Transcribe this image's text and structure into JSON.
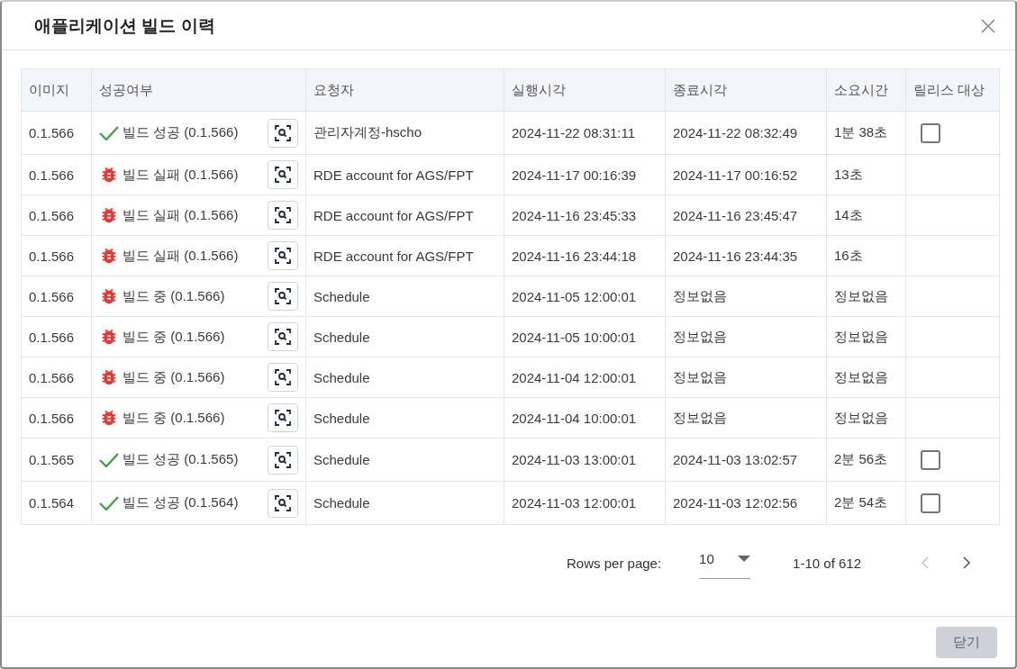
{
  "dialog": {
    "title": "애플리케이션 빌드 이력"
  },
  "table": {
    "columns": [
      "이미지",
      "성공여부",
      "요청자",
      "실행시각",
      "종료시각",
      "소요시간",
      "릴리스 대상"
    ],
    "rows": [
      {
        "image": "0.1.566",
        "kind": "success",
        "status": "빌드 성공 (0.1.566)",
        "requester": "관리자계정-hscho",
        "started": "2024-11-22 08:31:11",
        "ended": "2024-11-22 08:32:49",
        "duration": "1분 38초",
        "release": {
          "checked": false
        }
      },
      {
        "image": "0.1.566",
        "kind": "failed",
        "status": "빌드 실패 (0.1.566)",
        "requester": "RDE account for AGS/FPT",
        "started": "2024-11-17 00:16:39",
        "ended": "2024-11-17 00:16:52",
        "duration": "13초"
      },
      {
        "image": "0.1.566",
        "kind": "failed",
        "status": "빌드 실패 (0.1.566)",
        "requester": "RDE account for AGS/FPT",
        "started": "2024-11-16 23:45:33",
        "ended": "2024-11-16 23:45:47",
        "duration": "14초"
      },
      {
        "image": "0.1.566",
        "kind": "failed",
        "status": "빌드 실패 (0.1.566)",
        "requester": "RDE account for AGS/FPT",
        "started": "2024-11-16 23:44:18",
        "ended": "2024-11-16 23:44:35",
        "duration": "16초"
      },
      {
        "image": "0.1.566",
        "kind": "failed",
        "status": "빌드 중 (0.1.566)",
        "requester": "Schedule",
        "started": "2024-11-05 12:00:01",
        "ended": "정보없음",
        "duration": "정보없음"
      },
      {
        "image": "0.1.566",
        "kind": "failed",
        "status": "빌드 중 (0.1.566)",
        "requester": "Schedule",
        "started": "2024-11-05 10:00:01",
        "ended": "정보없음",
        "duration": "정보없음"
      },
      {
        "image": "0.1.566",
        "kind": "failed",
        "status": "빌드 중 (0.1.566)",
        "requester": "Schedule",
        "started": "2024-11-04 12:00:01",
        "ended": "정보없음",
        "duration": "정보없음"
      },
      {
        "image": "0.1.566",
        "kind": "failed",
        "status": "빌드 중 (0.1.566)",
        "requester": "Schedule",
        "started": "2024-11-04 10:00:01",
        "ended": "정보없음",
        "duration": "정보없음"
      },
      {
        "image": "0.1.565",
        "kind": "success",
        "status": "빌드 성공 (0.1.565)",
        "requester": "Schedule",
        "started": "2024-11-03 13:00:01",
        "ended": "2024-11-03 13:02:57",
        "duration": "2분 56초",
        "release": {
          "checked": false
        }
      },
      {
        "image": "0.1.564",
        "kind": "success",
        "status": "빌드 성공 (0.1.564)",
        "requester": "Schedule",
        "started": "2024-11-03 12:00:01",
        "ended": "2024-11-03 12:02:56",
        "duration": "2분 54초",
        "release": {
          "checked": false
        }
      }
    ]
  },
  "pagination": {
    "rows_per_page_label": "Rows per page:",
    "rows_per_page": "10",
    "range": "1-10 of 612",
    "prev_disabled": true,
    "next_disabled": false
  },
  "footer": {
    "close_button": "닫기",
    "close_disabled": true
  }
}
